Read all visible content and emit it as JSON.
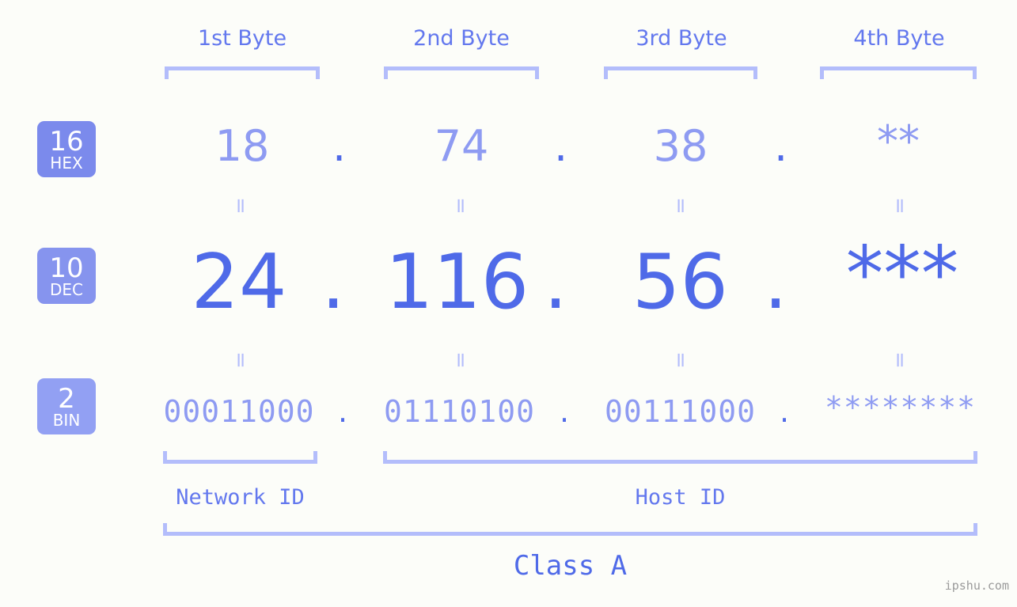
{
  "meta": {
    "background": "#fcfdf9",
    "accent_dark": "#4f6ae8",
    "accent_mid": "#6378ee",
    "accent_light": "#8e9bf2",
    "bracket": "#b3bdfb",
    "watermark": "ipshu.com"
  },
  "byte_headers": [
    {
      "label": "1st Byte"
    },
    {
      "label": "2nd Byte"
    },
    {
      "label": "3rd Byte"
    },
    {
      "label": "4th Byte"
    }
  ],
  "rows": [
    {
      "badge_num": "16",
      "badge_abbr": "HEX",
      "badge_color": "#7b8aec",
      "values": [
        "18",
        "74",
        "38",
        "**"
      ],
      "separators": [
        ".",
        ".",
        "."
      ]
    },
    {
      "badge_num": "10",
      "badge_abbr": "DEC",
      "badge_color": "#8694ee",
      "values": [
        "24",
        "116",
        "56",
        "***"
      ],
      "separators": [
        ".",
        ".",
        "."
      ]
    },
    {
      "badge_num": "2",
      "badge_abbr": "BIN",
      "badge_color": "#92a0f3",
      "values": [
        "00011000",
        "01110100",
        "00111000",
        "********"
      ],
      "separators": [
        ".",
        ".",
        "."
      ]
    }
  ],
  "equals_symbol": "=",
  "id_sections": [
    {
      "label": "Network ID"
    },
    {
      "label": "Host ID"
    }
  ],
  "class_section": {
    "label": "Class A"
  }
}
